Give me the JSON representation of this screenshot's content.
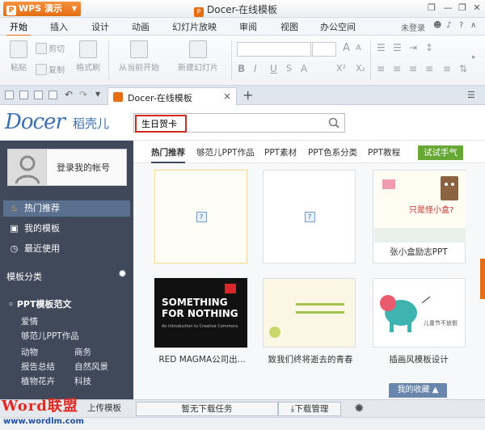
{
  "app": {
    "wps_button": "WPS 演示",
    "window_title": "Docer-在线模板",
    "user_status": "未登录"
  },
  "menu": [
    "开始",
    "插入",
    "设计",
    "动画",
    "幻灯片放映",
    "审阅",
    "视图",
    "办公空间"
  ],
  "ribbon": {
    "paste": "粘贴",
    "cut": "剪切",
    "copy": "复制",
    "format_painter": "格式刷",
    "from_current": "从当前开始",
    "new_slide": "新建幻灯片",
    "bold": "B",
    "italic": "I",
    "underline": "U",
    "superscript": "X²",
    "subscript": "X₂",
    "strike": "S",
    "font_grow": "A",
    "font_shrink": "A",
    "font_color": "A"
  },
  "document_tab": {
    "title": "Docer-在线模板",
    "close": "×",
    "add": "+"
  },
  "docer": {
    "logo_en": "Docer",
    "logo_cn": "稻壳儿",
    "search_value": "生日贺卡"
  },
  "sidebar": {
    "login": "登录我的帐号",
    "nav": [
      {
        "label": "热门推荐",
        "icon": "flame-icon"
      },
      {
        "label": "我的模板",
        "icon": "square-icon"
      },
      {
        "label": "最近使用",
        "icon": "clock-icon"
      }
    ],
    "category_header": "模板分类",
    "ppt_header": "PPT模板范文",
    "subs": [
      "爱情",
      "够范儿PPT作品",
      "动物",
      "商务",
      "报告总结",
      "自然风景",
      "植物花卉",
      "科技"
    ]
  },
  "content": {
    "categories": [
      "热门推荐",
      "够范儿PPT作品",
      "PPT素材",
      "PPT色系分类",
      "PPT教程"
    ],
    "try_button": "试试手气",
    "cards": [
      {
        "title": ""
      },
      {
        "title": ""
      },
      {
        "title": "张小盒励志PPT",
        "thumb_text": "只是怪小盒?"
      },
      {
        "title": "RED MAGMA公司出...",
        "thumb_text": "SOMETHING FOR NOTHING",
        "thumb_sub": "An Introduction to Creative Commons"
      },
      {
        "title": "致我们终将逝去的青春"
      },
      {
        "title": "插画风模板设计",
        "thumb_text": "儿童节不放假"
      }
    ],
    "favorites": "我的收藏 ▲"
  },
  "bottombar": {
    "upload": "上传模板",
    "no_tasks": "暂无下载任务",
    "download_manager": "下载管理"
  },
  "watermark": {
    "brand": "Word联盟",
    "url": "www.wordlm.com"
  },
  "colors": {
    "accent_orange": "#e56d14",
    "sidebar_bg": "#40495a",
    "try_green": "#66a836",
    "search_highlight": "#d02a1f"
  }
}
